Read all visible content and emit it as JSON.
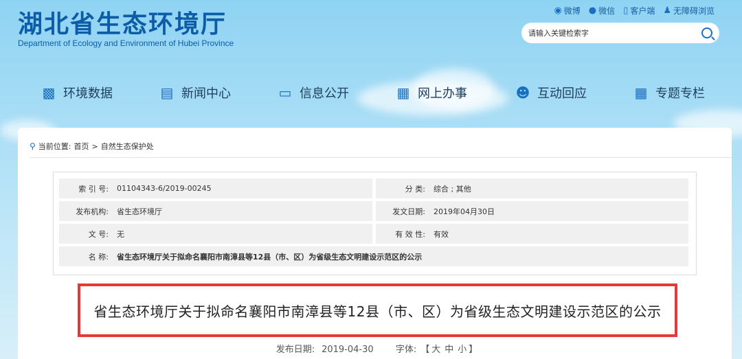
{
  "site": {
    "title_cn": "湖北省生态环境厅",
    "title_en": "Department of Ecology and Environment of Hubei Province"
  },
  "toplinks": [
    {
      "label": "微博",
      "icon": "weibo-icon"
    },
    {
      "label": "微信",
      "icon": "wechat-icon"
    },
    {
      "label": "客户端",
      "icon": "mobile-icon"
    },
    {
      "label": "无障碍浏览",
      "icon": "accessibility-icon"
    }
  ],
  "search": {
    "placeholder": "请输入关键检索字"
  },
  "nav": [
    {
      "label": "环境数据",
      "icon": "chart-icon"
    },
    {
      "label": "新闻中心",
      "icon": "news-icon"
    },
    {
      "label": "信息公开",
      "icon": "monitor-icon"
    },
    {
      "label": "网上办事",
      "icon": "form-icon"
    },
    {
      "label": "互动回应",
      "icon": "people-icon"
    },
    {
      "label": "专题专栏",
      "icon": "grid-icon"
    }
  ],
  "breadcrumb": {
    "prefix": "当前位置:",
    "home": "首页",
    "sep": ">",
    "current": "自然生态保护处"
  },
  "meta": {
    "index_label": "索 引 号:",
    "index_value": "01104343-6/2019-00245",
    "category_label": "分      类:",
    "category_value": "综合 ; 其他",
    "publisher_label": "发布机构:",
    "publisher_value": "省生态环境厅",
    "date_label": "发文日期:",
    "date_value": "2019年04月30日",
    "docno_label": "文      号:",
    "docno_value": "无",
    "validity_label": "有 效 性:",
    "validity_value": "有效",
    "name_label": "名      称:",
    "name_value": "省生态环境厅关于拟命名襄阳市南漳县等12县（市、区）为省级生态文明建设示范区的公示"
  },
  "article": {
    "title": "省生态环境厅关于拟命名襄阳市南漳县等12县（市、区）为省级生态文明建设示范区的公示",
    "pub_label": "发布日期:",
    "pub_date": "2019-04-30",
    "font_label": "字体:",
    "font_open": "【",
    "font_large": "大",
    "font_medium": "中",
    "font_small": "小",
    "font_close": "】"
  },
  "colors": {
    "brand": "#0d5ca8",
    "highlight_border": "#e53935"
  }
}
